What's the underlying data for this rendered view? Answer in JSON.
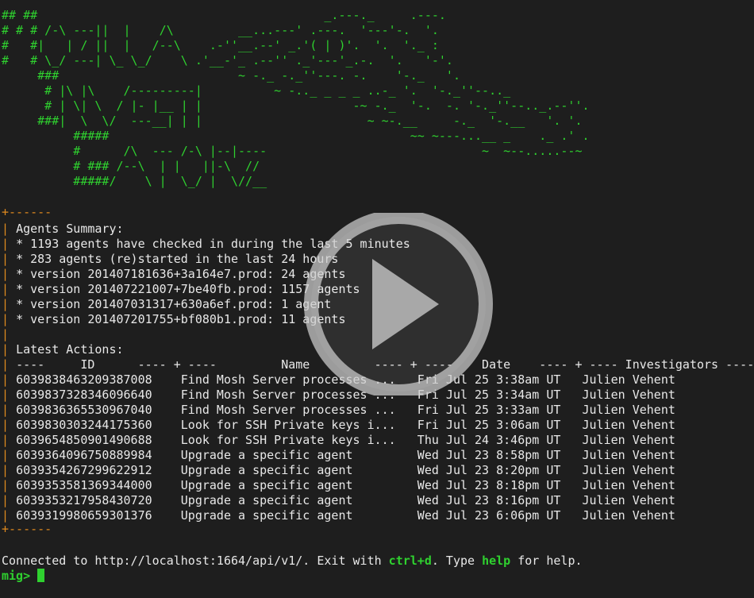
{
  "banner": {
    "ascii_lines": [
      "## ##                                        _.---._     .---.",
      "# # # /-\\ ---||  |    /\\         __...---' .---.  '---'-.  '.",
      "#   #|   | / ||  |   /--\\    .-''__.--' _.'( | )'.  '.  '._ :",
      "#   # \\_/ ---| \\_ \\_/    \\ .'__-'_ .--'' ._'---'_.-.  '.   '-'.",
      "     ###                         ~ -._ -._''---. -.    '-._   '.",
      "      # |\\ |\\    /---------|          ~ -.._ _ _ _ ..-_ '.  '-._''--.._",
      "      # | \\| \\  / |- |__ | |                     -~ -._  '-.  -. '-._''--.._.--''.",
      "     ###|  \\  \\/  ---__| | |                       ~ ~-.__     -._  '-.__   '. '.",
      "          #####                                          ~~ ~---...__ _    ._ .' .",
      "          #      /\\  --- /-\\ |--|----                              ~  ~--.....--~",
      "          # ### /--\\  | |   ||-\\  //",
      "          #####/    \\ |  \\_/ |  \\//__"
    ]
  },
  "summary": {
    "border_top": "+------",
    "title": "Agents Summary:",
    "items": [
      "* 1193 agents have checked in during the last 5 minutes",
      "* 283 agents (re)started in the last 24 hours",
      "* version 201407181636+3a164e7.prod: 24 agents",
      "* version 201407221007+7be40fb.prod: 1157 agents",
      "* version 201407031317+630a6ef.prod: 1 agent",
      "* version 201407201755+bf080b1.prod: 11 agents"
    ]
  },
  "actions": {
    "title": "Latest Actions:",
    "header": "----     ID      ---- + ----         Name         ---- + ----    Date    ---- + ---- Investigators ----",
    "rows": [
      "6039838463209387008    Find Mosh Server processes ...   Fri Jul 25 3:38am UT   Julien Vehent",
      "6039837328346096640    Find Mosh Server processes ...   Fri Jul 25 3:34am UT   Julien Vehent",
      "6039836365530967040    Find Mosh Server processes ...   Fri Jul 25 3:33am UT   Julien Vehent",
      "6039830303244175360    Look for SSH Private keys i...   Fri Jul 25 3:06am UT   Julien Vehent",
      "6039654850901490688    Look for SSH Private keys i...   Thu Jul 24 3:46pm UT   Julien Vehent",
      "6039364096750889984    Upgrade a specific agent         Wed Jul 23 8:58pm UT   Julien Vehent",
      "6039354267299622912    Upgrade a specific agent         Wed Jul 23 8:20pm UT   Julien Vehent",
      "6039353581369344000    Upgrade a specific agent         Wed Jul 23 8:18pm UT   Julien Vehent",
      "6039353217958430720    Upgrade a specific agent         Wed Jul 23 8:16pm UT   Julien Vehent",
      "6039319980659301376    Upgrade a specific agent         Wed Jul 23 6:06pm UT   Julien Vehent"
    ],
    "border_bottom": "+------"
  },
  "footer": {
    "connected_prefix": "Connected to http://localhost:1664/api/v1/. Exit with ",
    "ctrl_d": "ctrl+d",
    "type_text": ". Type ",
    "help_word": "help",
    "for_help": " for help.",
    "prompt": "mig>"
  },
  "colors": {
    "background": "#1e1e1e",
    "text": "#e8e8e8",
    "green": "#2fd12f",
    "orange": "#e08a1e"
  },
  "icons": {
    "play": "play-icon"
  }
}
